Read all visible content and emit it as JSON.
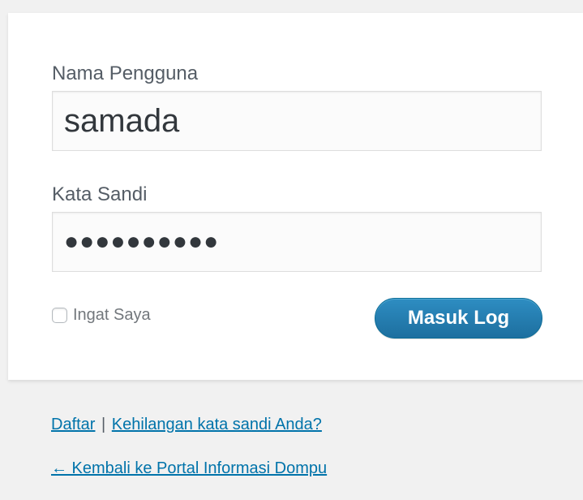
{
  "form": {
    "username_label": "Nama Pengguna",
    "username_value": "samada",
    "password_label": "Kata Sandi",
    "password_mask": "●●●●●●●●●●",
    "remember_label": "Ingat Saya",
    "remember_checked": false,
    "submit_label": "Masuk Log"
  },
  "links": {
    "register": "Daftar",
    "separator": "|",
    "lost_password": "Kehilangan kata sandi Anda?",
    "back_to_site": "← Kembali ke Portal Informasi Dompu"
  },
  "colors": {
    "background": "#f1f1f1",
    "card": "#ffffff",
    "link": "#0073aa",
    "button": "#2271b1",
    "label_text": "#555d66"
  }
}
